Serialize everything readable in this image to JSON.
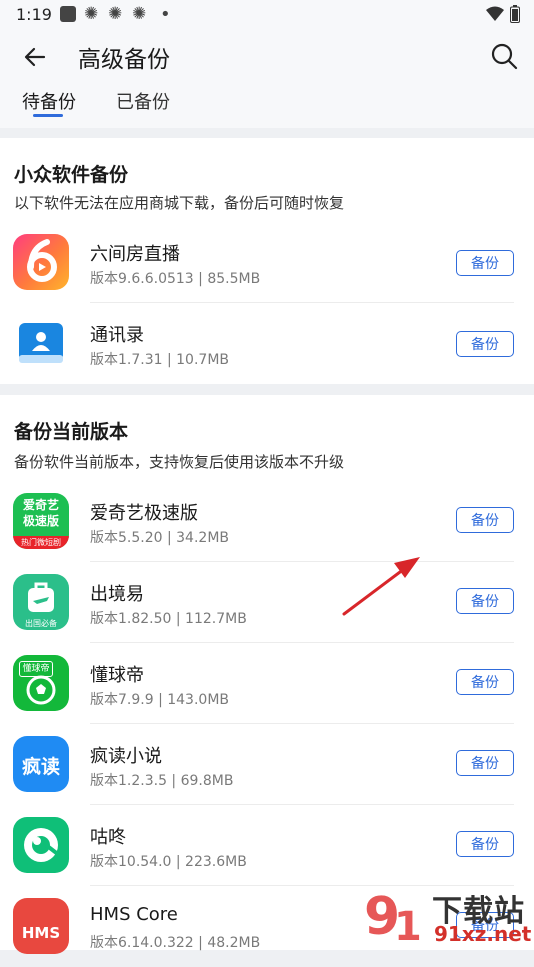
{
  "status": {
    "time": "1:19"
  },
  "header": {
    "title": "高级备份",
    "tabs": [
      "待备份",
      "已备份"
    ]
  },
  "section1": {
    "title": "小众软件备份",
    "desc": "以下软件无法在应用商城下载，备份后可随时恢复",
    "apps": [
      {
        "name": "六间房直播",
        "meta": "版本9.6.6.0513 | 85.5MB",
        "button": "备份"
      },
      {
        "name": "通讯录",
        "meta": "版本1.7.31 | 10.7MB",
        "button": "备份"
      }
    ]
  },
  "section2": {
    "title": "备份当前版本",
    "desc": "备份软件当前版本，支持恢复后使用该版本不升级",
    "apps": [
      {
        "name": "爱奇艺极速版",
        "meta": "版本5.5.20 | 34.2MB",
        "button": "备份",
        "icon_text": "爱奇艺",
        "icon_text2": "极速版",
        "icon_sub": "热门微短剧"
      },
      {
        "name": "出境易",
        "meta": "版本1.82.50 | 112.7MB",
        "button": "备份",
        "icon_sub": "出国必备"
      },
      {
        "name": "懂球帝",
        "meta": "版本7.9.9 | 143.0MB",
        "button": "备份",
        "icon_text": "懂球帝"
      },
      {
        "name": "疯读小说",
        "meta": "版本1.2.3.5 | 69.8MB",
        "button": "备份",
        "icon_text": "疯读"
      },
      {
        "name": "咕咚",
        "meta": "版本10.54.0 | 223.6MB",
        "button": "备份"
      },
      {
        "name": "HMS Core",
        "meta": "版本6.14.0.322 | 48.2MB",
        "button": "备份",
        "icon_text": "HMS"
      }
    ]
  },
  "watermark": {
    "text": "下载站",
    "sub": "91xz.net"
  },
  "colors": {
    "accent": "#2f6bdb",
    "arrow": "#d8262a"
  }
}
